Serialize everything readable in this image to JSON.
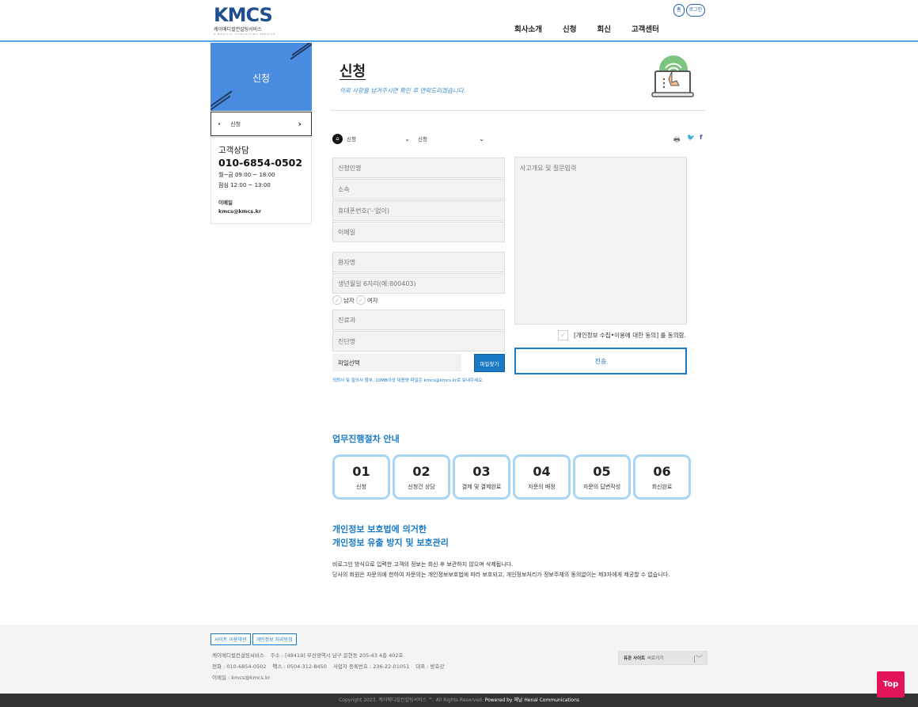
{
  "header": {
    "logo_text": "KMCS",
    "logo_sub": "케이메디컬컨설팅서비스",
    "logo_sub2": "K-MEDICAL CONSULTING SERVICE",
    "top_links": [
      "홈",
      "로그인"
    ],
    "nav": [
      "회사소개",
      "신청",
      "회신",
      "고객센터"
    ]
  },
  "sidebar": {
    "banner_title": "신청",
    "menu_dot": "•",
    "menu_label": "신청",
    "menu_chevron": "›",
    "info_title": "고객상담",
    "phone": "010-6854-0502",
    "hours_1": "월~금 09:00 ~ 18:00",
    "hours_2": "점심 12:00 ~ 13:00",
    "email_label": "이메일",
    "email": "kmcs@kmcs.kr"
  },
  "main": {
    "title": "신청",
    "subtitle": "의뢰 사항을 남겨주시면 확인 후 연락드리겠습니다.",
    "breadcrumb": [
      "신청",
      "신청"
    ],
    "share_icons": [
      "print-icon",
      "twitter-icon",
      "facebook-icon"
    ]
  },
  "form": {
    "applicant": "신청인명",
    "affiliation": "소속",
    "phone": "휴대폰번호('-'없이)",
    "email": "이메일",
    "patient": "환자명",
    "birth": "생년월일 6자리(예:800403)",
    "gender_male": "남자",
    "gender_female": "여자",
    "department": "진료과",
    "diagnosis": "진단명",
    "file_label": "파일선택",
    "file_button": "파일찾기",
    "file_note": "의뢰서 및 질의서 첨부, 10MB이상 대용량 파일은 kmcs@kmcs.kr로 보내주세요.",
    "question": "사고개요 및 질문입력",
    "agree": "[개인정보 수집•이용에 대한 동의] 를 동의함.",
    "submit": "전송"
  },
  "process": {
    "title": "업무진행절차 안내",
    "steps": [
      {
        "num": "01",
        "label": "신청"
      },
      {
        "num": "02",
        "label": "신청건 상담"
      },
      {
        "num": "03",
        "label": "결제 및 결제완료"
      },
      {
        "num": "04",
        "label": "자문의 배정"
      },
      {
        "num": "05",
        "label": "자문의 답변작성"
      },
      {
        "num": "06",
        "label": "회신완료"
      }
    ]
  },
  "privacy": {
    "title_1": "개인정보 보호법에 의거한",
    "title_2": "개인정보 유출 방지 및 보호관리",
    "text_1": "비로그인 방식으로 입력한 고객의 정보는 회신 후 보관하지 않으며 삭제됩니다.",
    "text_2": "당사의 회원은 자문의에 한하여 자문의는 개인정보보호법에 따라 보호되고, 개인정보처리가 정보주체의 동의없이는 제3자에게 제공할 수 없습니다."
  },
  "footer": {
    "links": [
      "사이트 이용약관",
      "개인정보 처리방침"
    ],
    "company": "케이메디컬컨설팅서비스",
    "address": "주소 : [48419] 부산광역시 남구 문현동 205-43 4층 402호",
    "phone": "전화 : 010-6854-0502",
    "fax": "팩스 : 0504-312-8450",
    "biz_no": "사업자 등록번호 : 236-22-01051",
    "ceo": "대표 : 방효강",
    "email": "이메일 : kmcs@kmcs.kr",
    "family_bold": "유관 사이트",
    "family_text": "바로가기",
    "copyright": "Copyright 2023. 케이메디컬컨설팅서비스 ™. All Rights Reserved.",
    "powered": "Powered by 헤날 Henal Communications",
    "top": "Top"
  },
  "colors": {
    "accent": "#1a7ac6",
    "banner": "#4a8de0",
    "top_button": "#e3145c"
  }
}
